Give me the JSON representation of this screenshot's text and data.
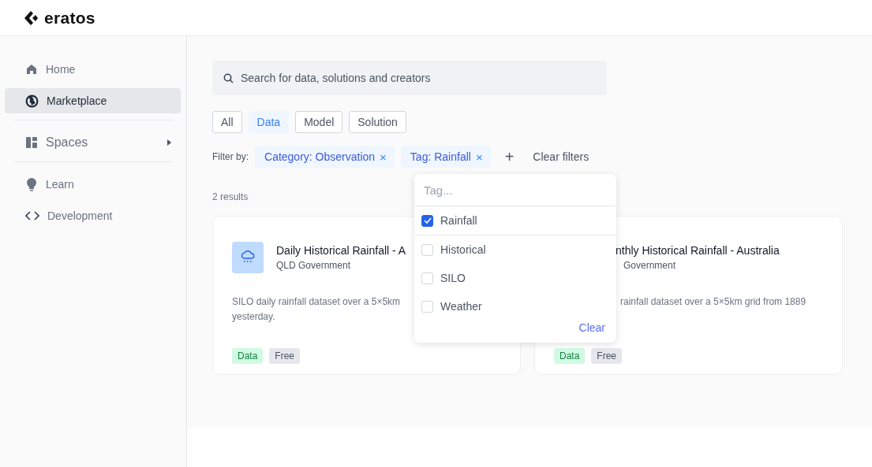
{
  "brand": {
    "name": "eratos"
  },
  "sidebar": {
    "items": [
      {
        "label": "Home",
        "selected": false
      },
      {
        "label": "Marketplace",
        "selected": true
      },
      {
        "kind": "divider"
      },
      {
        "label": "Spaces",
        "selected": false,
        "expandable": true
      },
      {
        "kind": "divider"
      },
      {
        "label": "Learn",
        "selected": false
      },
      {
        "label": "Development",
        "selected": false
      }
    ]
  },
  "search": {
    "placeholder": "Search for data, solutions and creators"
  },
  "type_tabs": [
    {
      "label": "All",
      "selected": false
    },
    {
      "label": "Data",
      "selected": true
    },
    {
      "label": "Model",
      "selected": false
    },
    {
      "label": "Solution",
      "selected": false
    }
  ],
  "filters": {
    "label": "Filter by:",
    "chips": [
      {
        "key": "Category:",
        "value": "Observation",
        "remove": "×"
      },
      {
        "key": "Tag:",
        "value": "Rainfall",
        "remove": "×"
      }
    ],
    "add": "+",
    "clear": "Clear filters"
  },
  "results_count": "2 results",
  "cards": [
    {
      "title": "Daily Historical Rainfall - A",
      "publisher": "QLD Government",
      "description": "SILO daily rainfall dataset over a 5×5km",
      "description_2": "yesterday.",
      "tags": [
        {
          "label": "Data",
          "color": "#d1fae5"
        },
        {
          "label": "Free",
          "color": "#e5e7eb"
        }
      ]
    },
    {
      "title": "nthly Historical Rainfall - Australia",
      "publisher": "Government",
      "description": "rainfall dataset over a 5×5km grid from 1889",
      "tags": [
        {
          "label": "Data",
          "color": "#d1fae5"
        },
        {
          "label": "Free",
          "color": "#e5e7eb"
        }
      ]
    }
  ],
  "tag_dropdown": {
    "placeholder": "Tag...",
    "options": [
      {
        "label": "Rainfall",
        "checked": true
      },
      {
        "label": "Historical",
        "checked": false
      },
      {
        "label": "SILO",
        "checked": false
      },
      {
        "label": "Weather",
        "checked": false
      }
    ],
    "clear": "Clear"
  }
}
